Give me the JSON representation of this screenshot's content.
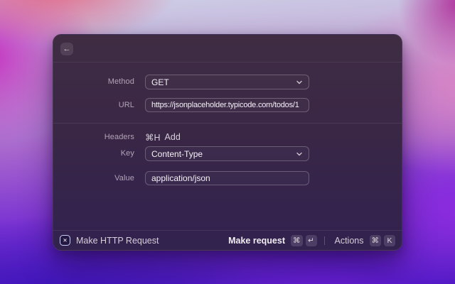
{
  "window": {
    "header": {
      "back_icon": "←"
    },
    "form": {
      "method": {
        "label": "Method",
        "value": "GET"
      },
      "url": {
        "label": "URL",
        "value": "https://jsonplaceholder.typicode.com/todos/1"
      },
      "headers": {
        "label": "Headers",
        "shortcut_hint": "⌘H",
        "add_label": "Add"
      },
      "key": {
        "label": "Key",
        "value": "Content-Type"
      },
      "value": {
        "label": "Value",
        "value": "application/json"
      }
    },
    "footer": {
      "extension_icon": "✕",
      "title": "Make HTTP Request",
      "primary_action_label": "Make request",
      "primary_shortcut_keys": [
        "⌘",
        "↵"
      ],
      "secondary_action_label": "Actions",
      "secondary_shortcut_keys": [
        "⌘",
        "K"
      ]
    }
  },
  "colors": {
    "window_background_top": "#3f2c43",
    "window_background_bottom": "#32224e",
    "field_border": "rgba(255,255,255,0.24)",
    "wallpaper_magenta": "#c32ec0",
    "wallpaper_pink": "#d883c4",
    "wallpaper_lavender": "#cdd1e6",
    "wallpaper_violet": "#6a1fd6",
    "wallpaper_deep_blue": "#3a13b8"
  }
}
